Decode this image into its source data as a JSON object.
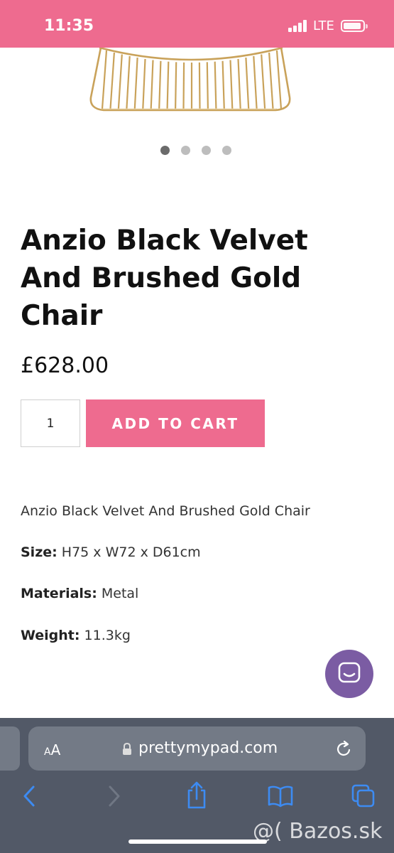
{
  "status_bar": {
    "time": "11:35",
    "network": "LTE"
  },
  "product": {
    "title": "Anzio Black Velvet And Brushed Gold Chair",
    "price": "£628.00",
    "quantity": "1",
    "add_to_cart_label": "ADD TO CART",
    "image_slides": 4,
    "active_slide": 1
  },
  "description": {
    "intro": "Anzio Black Velvet And Brushed Gold Chair",
    "size_label": "Size:",
    "size_value": "H75 x W72 x D61cm",
    "materials_label": "Materials:",
    "materials_value": "Metal",
    "weight_label": "Weight:",
    "weight_value": "11.3kg"
  },
  "browser": {
    "text_size_big": "A",
    "text_size_small": "A",
    "url": "prettymypad.com"
  },
  "watermark": "@( Bazos.sk",
  "colors": {
    "brand_pink": "#ee6b8f",
    "chat_purple": "#7b5ca3",
    "browser_toolbar": "#525967",
    "ios_blue": "#3d8bf2"
  },
  "icons": {
    "chat": "chat-bubble-icon",
    "lock": "lock-icon",
    "reload": "reload-icon",
    "back": "chevron-left-icon",
    "forward": "chevron-right-icon",
    "share": "share-icon",
    "bookmarks": "book-icon",
    "tabs": "tabs-icon"
  }
}
